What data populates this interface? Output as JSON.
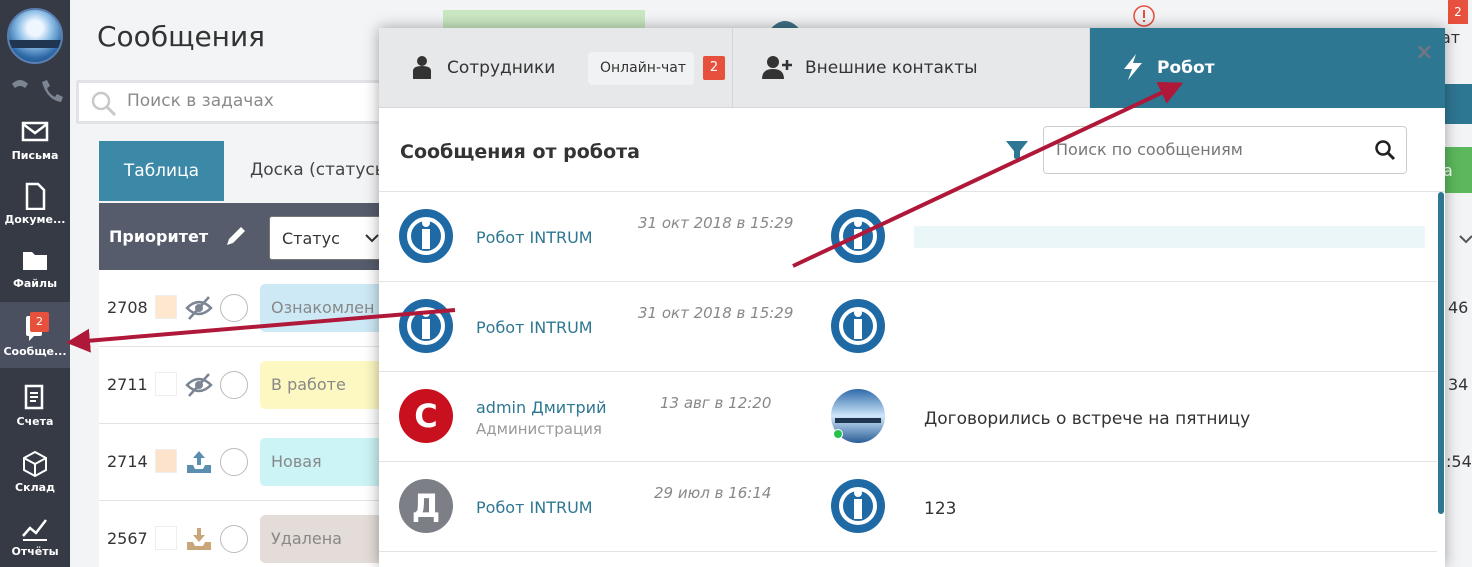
{
  "sidebar": {
    "items": [
      {
        "label": "Письма",
        "icon": "envelope-icon"
      },
      {
        "label": "Докуме...",
        "icon": "document-icon"
      },
      {
        "label": "Файлы",
        "icon": "folder-icon"
      },
      {
        "label": "Сообще...",
        "icon": "messages-icon",
        "badge": "2"
      },
      {
        "label": "Счета",
        "icon": "invoice-icon"
      },
      {
        "label": "Склад",
        "icon": "warehouse-icon"
      },
      {
        "label": "Отчёты",
        "icon": "chart-icon"
      }
    ]
  },
  "page": {
    "title": "Сообщения",
    "search_placeholder": "Поиск в задачах",
    "view_tabs": {
      "table": "Таблица",
      "board": "Доска (статусы)"
    },
    "priority_header": "Приоритет",
    "status_filter": "Статус",
    "rows": [
      {
        "id": "2708",
        "status": "Ознакомлен",
        "status_color": "#cde9f6",
        "prio_color": "#fde7cf"
      },
      {
        "id": "2711",
        "status": "В работе",
        "status_color": "#fdf8c2",
        "prio_color": "#ffffff"
      },
      {
        "id": "2714",
        "status": "Новая",
        "status_color": "#ccf4f6",
        "prio_color": "#fde2cc"
      },
      {
        "id": "2567",
        "status": "Удалена",
        "status_color": "#e4dcd8",
        "prio_color": "#ffffff"
      }
    ],
    "right_fragments": {
      "badge": "2",
      "a": "46",
      "b": "34",
      "c": ":54",
      "d": "а",
      "e": "ат"
    }
  },
  "modal": {
    "tabs": {
      "employees": "Сотрудники",
      "online_chat": "Онлайн-чат",
      "online_chat_badge": "2",
      "external": "Внешние контакты",
      "robot": "Робот"
    },
    "close": "×",
    "header_title": "Сообщения от робота",
    "search_placeholder": "Поиск по сообщениям",
    "messages": [
      {
        "sender": "Робот INTRUM",
        "dept": "",
        "date": "31 окт 2018 в 15:29",
        "text": ""
      },
      {
        "sender": "Робот INTRUM",
        "dept": "",
        "date": "31 окт 2018 в 15:29",
        "text": ""
      },
      {
        "sender": "admin Дмитрий",
        "dept": "Администрация",
        "date": "13 авг в 12:20",
        "text": "Договорились о встрече на пятницу",
        "avatar_letter": "С"
      },
      {
        "sender": "Робот INTRUM",
        "dept": "",
        "date": "29 июл в 16:14",
        "text": "123",
        "avatar_letter": "Д"
      }
    ]
  },
  "colors": {
    "accent": "#2e7793",
    "badge": "#e7503c",
    "sidebar": "#353a45",
    "arrow": "#b0183a"
  }
}
